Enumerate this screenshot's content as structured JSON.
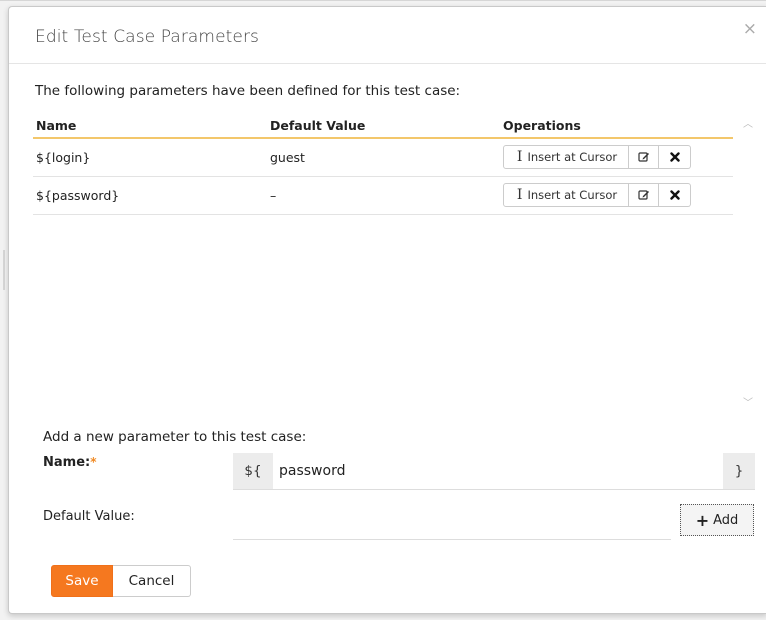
{
  "dialog": {
    "title": "Edit Test Case Parameters",
    "close_glyph": "×",
    "intro_text": "The following parameters have been defined for this test case:"
  },
  "table": {
    "headers": [
      "Name",
      "Default Value",
      "Operations"
    ],
    "rows": [
      {
        "name": "${login}",
        "default_value": "guest"
      },
      {
        "name": "${password}",
        "default_value": "–"
      }
    ],
    "ops": {
      "insert_label": "Insert at Cursor",
      "insert_icon": "text-cursor-icon",
      "edit_icon": "edit-icon",
      "delete_icon": "delete-icon"
    }
  },
  "add_form": {
    "title": "Add a new parameter to this test case:",
    "name_label": "Name:",
    "required_marker": "*",
    "name_prefix": "${",
    "name_value": "password",
    "name_suffix": "}",
    "default_label": "Default Value:",
    "default_value": "",
    "add_label": "Add"
  },
  "footer": {
    "save_label": "Save",
    "cancel_label": "Cancel"
  },
  "colors": {
    "accent": "#f5781f",
    "header_underline": "#f3c76b",
    "required": "#f08a24"
  }
}
